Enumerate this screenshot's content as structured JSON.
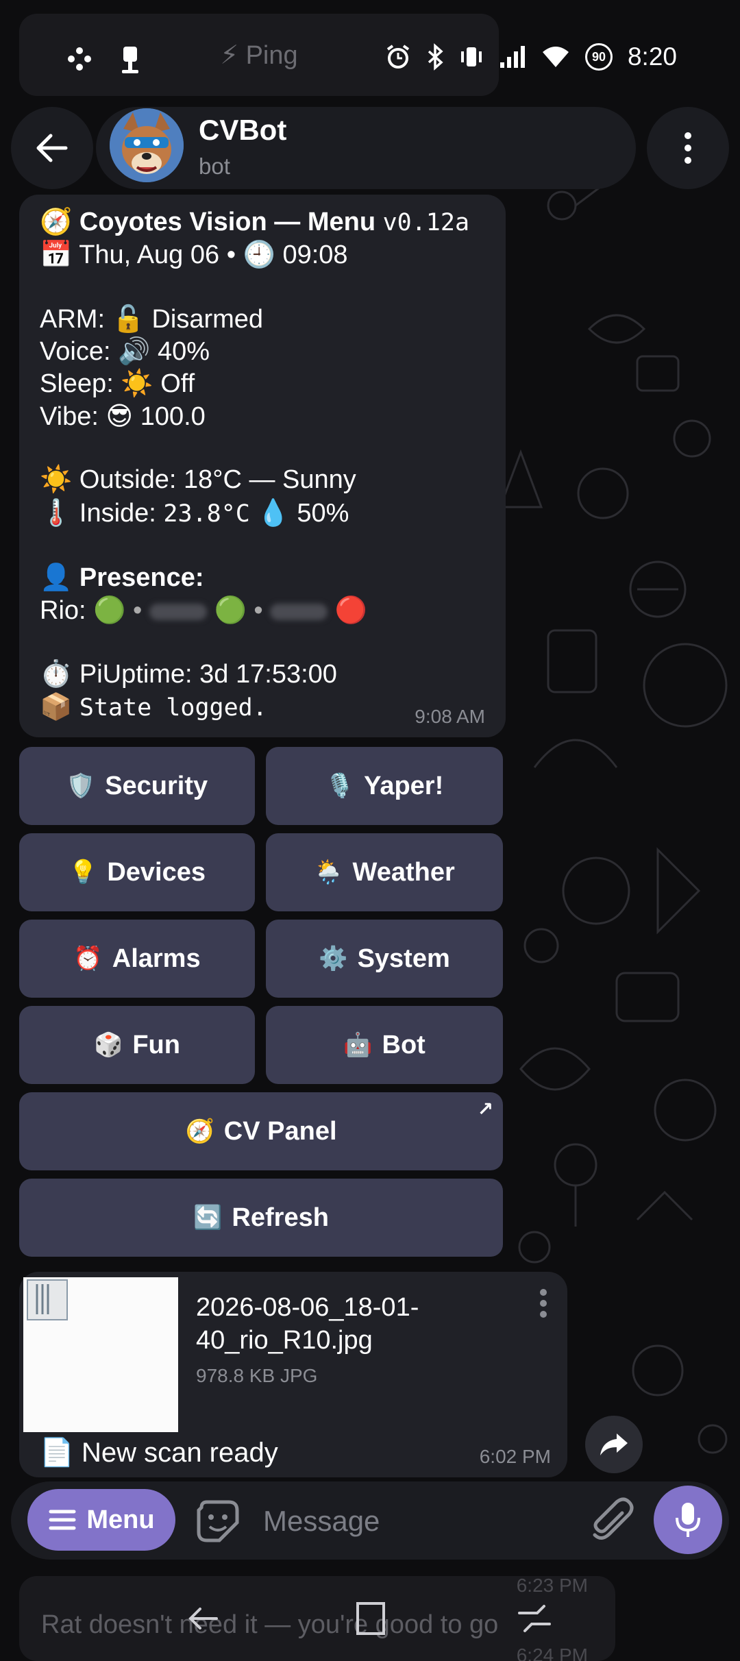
{
  "status_bar": {
    "time": "8:20",
    "battery_level": "90"
  },
  "header": {
    "title": "CVBot",
    "subtitle": "bot"
  },
  "background_messages": {
    "top_button": "⚡ Ping",
    "bottom_text_1": "Rat doesn't need it — you're good to go",
    "bottom_time_1": "6:23 PM",
    "bottom_time_2": "6:24 PM"
  },
  "menu_message": {
    "title_icon": "🧭",
    "title": "Coyotes Vision — Menu",
    "version": "v0.12a",
    "date_icon": "📅",
    "date": "Thu, Aug 06",
    "separator": "•",
    "time_icon": "🕘",
    "time": "09:08",
    "arm_label": "ARM:",
    "arm_icon": "🔓",
    "arm_value": "Disarmed",
    "voice_label": "Voice:",
    "voice_icon": "🔊",
    "voice_value": "40%",
    "sleep_label": "Sleep:",
    "sleep_icon": "☀️",
    "sleep_value": "Off",
    "vibe_label": "Vibe:",
    "vibe_icon": "😎",
    "vibe_value": "100.0",
    "outside_icon": "☀️",
    "outside_label": "Outside:",
    "outside_value": "18°C — Sunny",
    "inside_icon": "🌡️",
    "inside_label": "Inside:",
    "inside_value": "23.8°C",
    "humidity_icon": "💧",
    "humidity_value": "50%",
    "presence_icon": "👤",
    "presence_label": "Presence:",
    "presence_name": "Rio:",
    "presence_status": [
      "🟢",
      "🟢",
      "🔴"
    ],
    "uptime_icon": "⏱️",
    "uptime_label": "PiUptime:",
    "uptime_value": "3d 17:53:00",
    "log_icon": "📦",
    "log_text": "State logged.",
    "timestamp": "9:08 AM"
  },
  "keyboard": {
    "security": {
      "icon": "🛡️",
      "label": "Security"
    },
    "yaper": {
      "icon": "🎙️",
      "label": "Yaper!"
    },
    "devices": {
      "icon": "💡",
      "label": "Devices"
    },
    "weather": {
      "icon": "🌦️",
      "label": "Weather"
    },
    "alarms": {
      "icon": "⏰",
      "label": "Alarms"
    },
    "system": {
      "icon": "⚙️",
      "label": "System"
    },
    "fun": {
      "icon": "🎲",
      "label": "Fun"
    },
    "bot": {
      "icon": "🤖",
      "label": "Bot"
    },
    "cv_panel": {
      "icon": "🧭",
      "label": "CV Panel",
      "link_icon": "↗"
    },
    "refresh": {
      "icon": "🔄",
      "label": "Refresh"
    }
  },
  "file_message": {
    "file_name": "2026-08-06_18-01-40_rio_R10.jpg",
    "file_meta": "978.8 KB JPG",
    "caption_icon": "📄",
    "caption": "New scan ready",
    "timestamp": "6:02 PM"
  },
  "composer": {
    "menu_label": "Menu",
    "placeholder": "Message"
  },
  "colors": {
    "accent": "#8273c9",
    "bubble": "#202127",
    "keyboard_button": "#3b3c52",
    "background": "#0d0d0f"
  }
}
